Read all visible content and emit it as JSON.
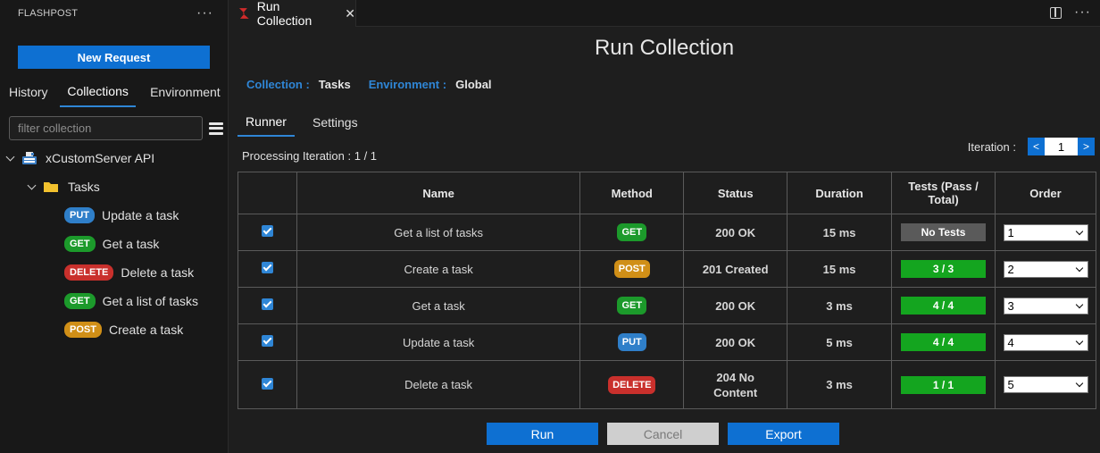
{
  "sidebar": {
    "title": "FLASHPOST",
    "more_icon": "ellipsis-icon",
    "new_request_label": "New Request",
    "tabs": [
      {
        "label": "History"
      },
      {
        "label": "Collections"
      },
      {
        "label": "Environment"
      }
    ],
    "active_tab": "Collections",
    "filter_placeholder": "filter collection",
    "collection": {
      "name": "xCustomServer API",
      "folder": "Tasks",
      "requests": [
        {
          "method": "PUT",
          "name": "Update a task"
        },
        {
          "method": "GET",
          "name": "Get a task"
        },
        {
          "method": "DELETE",
          "name": "Delete a task"
        },
        {
          "method": "GET",
          "name": "Get a list of tasks"
        },
        {
          "method": "POST",
          "name": "Create a task"
        }
      ]
    }
  },
  "editor": {
    "tab_title": "Run Collection",
    "close_glyph": "✕",
    "more_glyph": "···"
  },
  "runner": {
    "title": "Run Collection",
    "collection_label": "Collection :",
    "collection_value": "Tasks",
    "environment_label": "Environment :",
    "environment_value": "Global",
    "tabs": [
      "Runner",
      "Settings"
    ],
    "processing": "Processing Iteration : 1 / 1",
    "iteration_label": "Iteration :",
    "iteration_value": "1",
    "prev_glyph": "<",
    "next_glyph": ">",
    "columns": [
      "",
      "Name",
      "Method",
      "Status",
      "Duration",
      "Tests (Pass / Total)",
      "Order"
    ],
    "rows": [
      {
        "checked": true,
        "name": "Get a list of tasks",
        "method": "GET",
        "status": "200 OK",
        "duration": "15 ms",
        "tests": "No Tests",
        "order": "1"
      },
      {
        "checked": true,
        "name": "Create a task",
        "method": "POST",
        "status": "201 Created",
        "duration": "15 ms",
        "tests": "3 / 3",
        "order": "2"
      },
      {
        "checked": true,
        "name": "Get a task",
        "method": "GET",
        "status": "200 OK",
        "duration": "3 ms",
        "tests": "4 / 4",
        "order": "3"
      },
      {
        "checked": true,
        "name": "Update a task",
        "method": "PUT",
        "status": "200 OK",
        "duration": "5 ms",
        "tests": "4 / 4",
        "order": "4"
      },
      {
        "checked": true,
        "name": "Delete a task",
        "method": "DELETE",
        "status": "204 No Content",
        "duration": "3 ms",
        "tests": "1 / 1",
        "order": "5"
      }
    ],
    "buttons": {
      "run": "Run",
      "cancel": "Cancel",
      "export": "Export"
    }
  },
  "colors": {
    "accent": "#0e70d2",
    "get": "#1c9a2b",
    "post": "#d08f17",
    "put": "#2f7fc9",
    "delete": "#c9302c",
    "success_text": "#3fb34f"
  }
}
